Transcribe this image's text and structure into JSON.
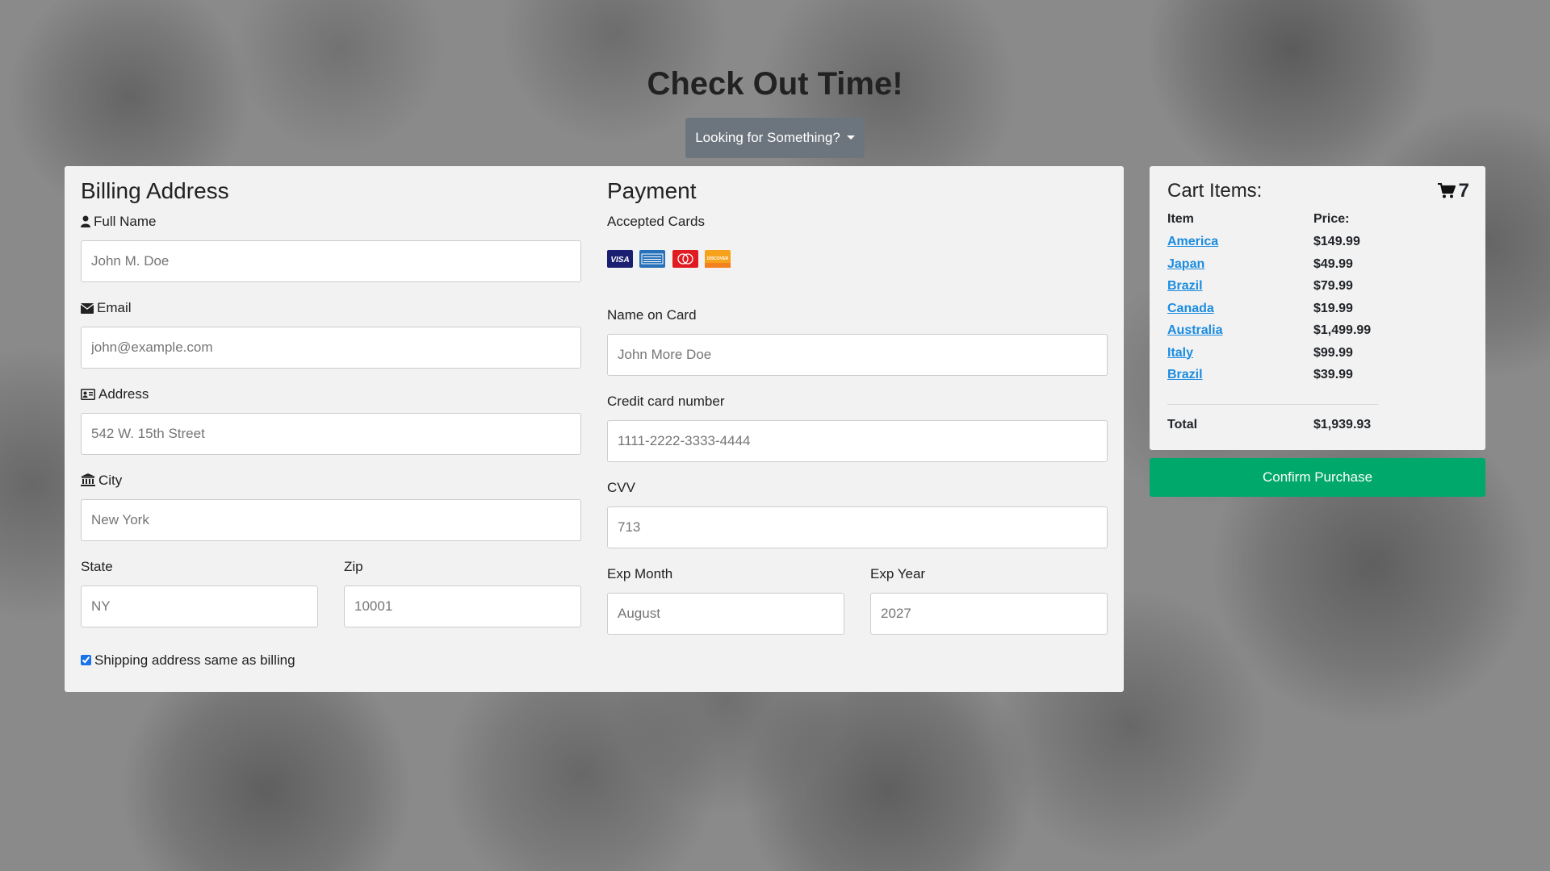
{
  "header": {
    "title": "Check Out Time!",
    "dropdown_label": "Looking for Something?"
  },
  "billing": {
    "title": "Billing Address",
    "full_name": {
      "label": "Full Name",
      "placeholder": "John M. Doe"
    },
    "email": {
      "label": "Email",
      "placeholder": "john@example.com"
    },
    "address": {
      "label": "Address",
      "placeholder": "542 W. 15th Street"
    },
    "city": {
      "label": "City",
      "placeholder": "New York"
    },
    "state": {
      "label": "State",
      "placeholder": "NY"
    },
    "zip": {
      "label": "Zip",
      "placeholder": "10001"
    },
    "same_as_billing": {
      "label": "Shipping address same as billing",
      "checked": true
    }
  },
  "payment": {
    "title": "Payment",
    "accepted_cards_label": "Accepted Cards",
    "card_icons": [
      "visa-icon",
      "amex-icon",
      "mastercard-icon",
      "discover-icon"
    ],
    "name_on_card": {
      "label": "Name on Card",
      "placeholder": "John More Doe"
    },
    "card_number": {
      "label": "Credit card number",
      "placeholder": "1111-2222-3333-4444"
    },
    "cvv": {
      "label": "CVV",
      "placeholder": "713"
    },
    "exp_month": {
      "label": "Exp Month",
      "placeholder": "August"
    },
    "exp_year": {
      "label": "Exp Year",
      "placeholder": "2027"
    }
  },
  "cart": {
    "title": "Cart Items:",
    "count": "7",
    "item_header": "Item",
    "price_header": "Price:",
    "items": [
      {
        "name": "America",
        "price": "$149.99"
      },
      {
        "name": "Japan",
        "price": "$49.99"
      },
      {
        "name": "Brazil",
        "price": "$79.99"
      },
      {
        "name": "Canada",
        "price": "$19.99"
      },
      {
        "name": "Australia",
        "price": "$1,499.99"
      },
      {
        "name": "Italy",
        "price": "$99.99"
      },
      {
        "name": "Brazil",
        "price": "$39.99"
      }
    ],
    "total_label": "Total",
    "total_value": "$1,939.93"
  },
  "actions": {
    "confirm_label": "Confirm Purchase"
  },
  "colors": {
    "confirm": "#00a86b",
    "dropdown": "#6c757d",
    "link": "#1a8ce0",
    "card_bg": "#f2f2f2"
  }
}
